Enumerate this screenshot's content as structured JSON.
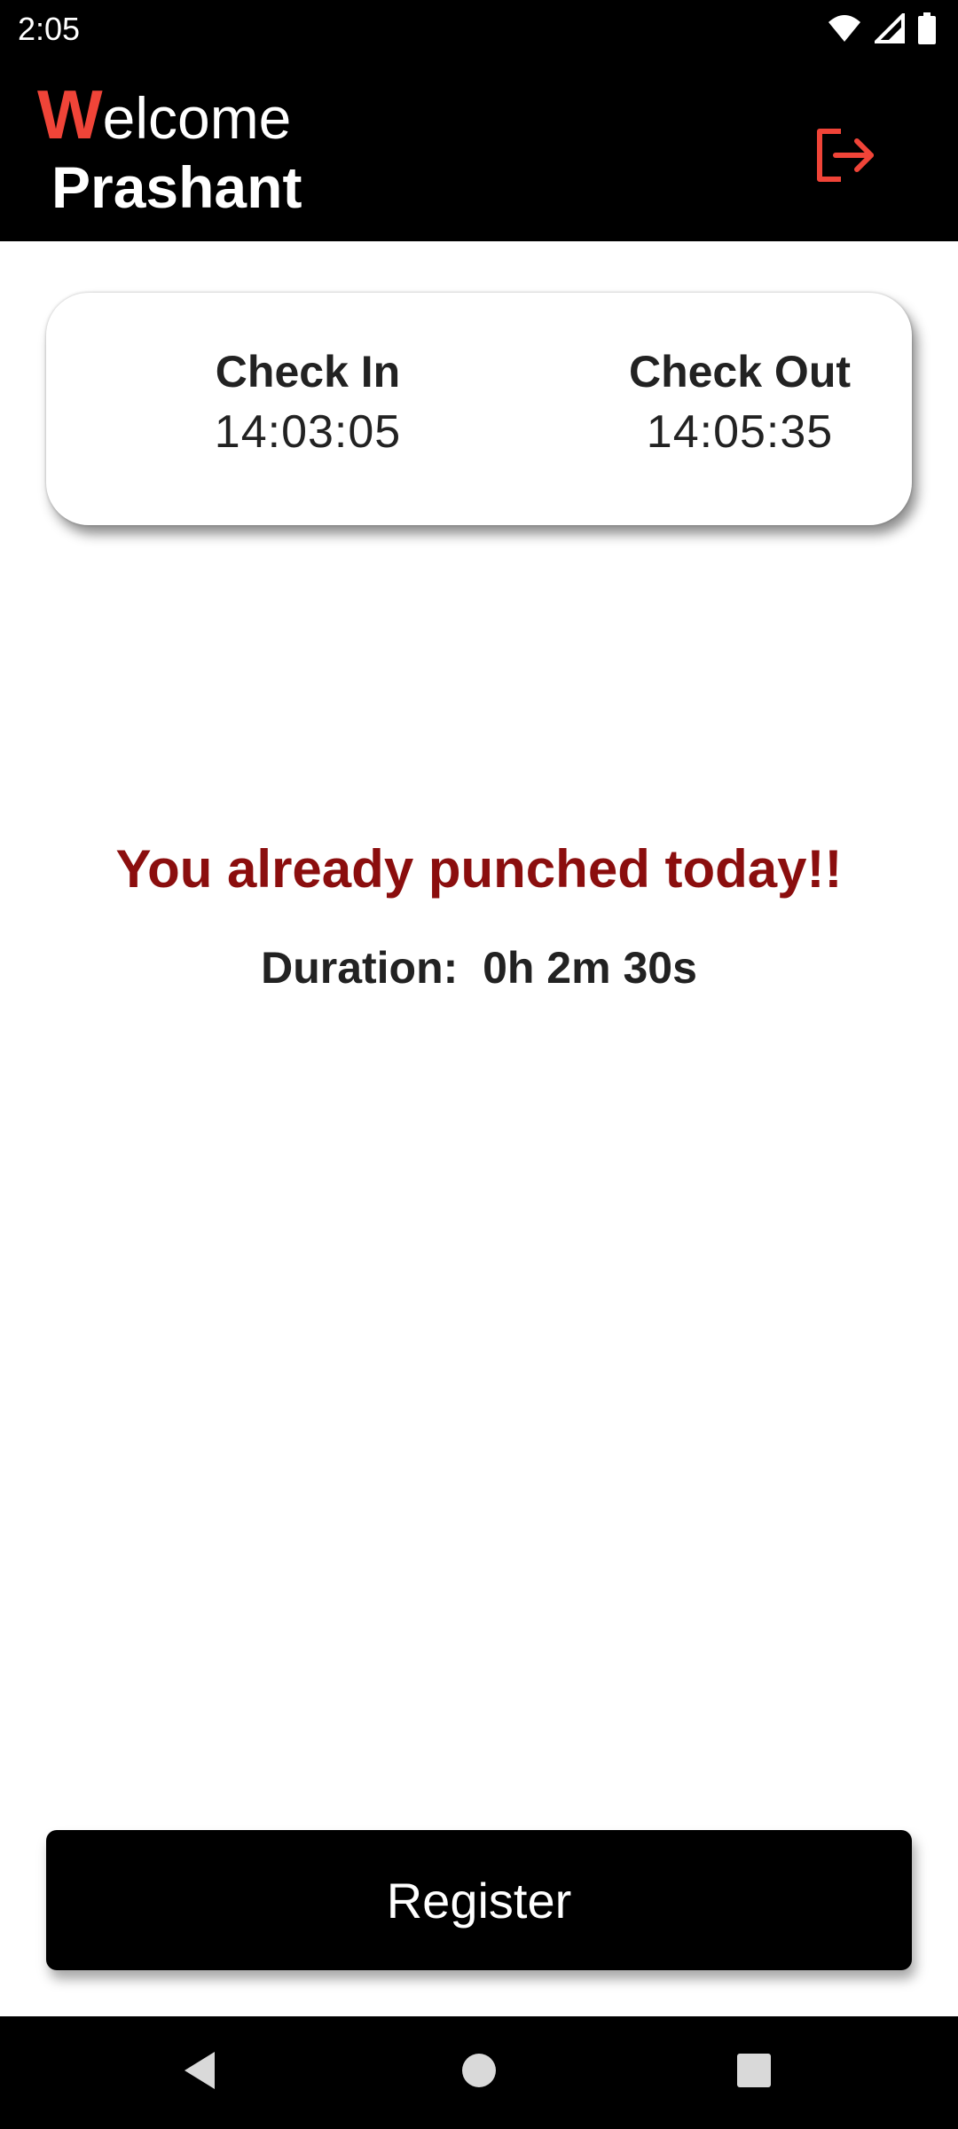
{
  "status_bar": {
    "time": "2:05",
    "icons": [
      "wifi-icon",
      "signal-icon",
      "battery-icon"
    ]
  },
  "header": {
    "welcome_first_letter": "W",
    "welcome_rest": "elcome",
    "user_name": "Prashant",
    "logout_icon": "logout-icon"
  },
  "time_card": {
    "check_in_label": "Check In",
    "check_in_time": "14:03:05",
    "check_out_label": "Check Out",
    "check_out_time": "14:05:35"
  },
  "message": {
    "punch_status": "You already punched today!!",
    "duration_text": "Duration:  0h 2m 30s"
  },
  "actions": {
    "register_label": "Register"
  },
  "nav_bar": {
    "icons": [
      "back-icon",
      "home-icon",
      "recents-icon"
    ]
  },
  "colors": {
    "accent_red": "#f04438",
    "message_red": "#8b0e0e",
    "header_bg": "#000000",
    "button_bg": "#000000"
  }
}
